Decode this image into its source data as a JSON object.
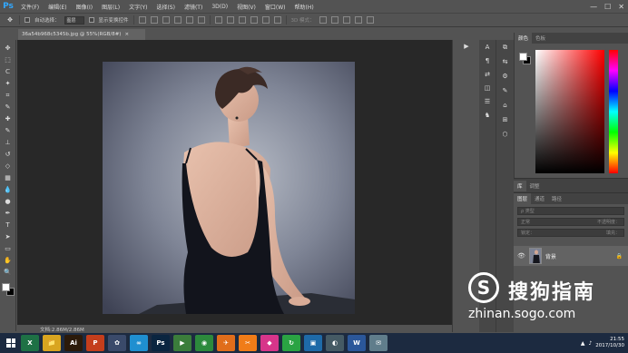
{
  "app": {
    "logo": "Ps"
  },
  "menu": [
    "文件(F)",
    "编辑(E)",
    "图像(I)",
    "图层(L)",
    "文字(Y)",
    "选择(S)",
    "滤镜(T)",
    "3D(D)",
    "视图(V)",
    "窗口(W)",
    "帮助(H)"
  ],
  "window_controls": [
    "—",
    "☐",
    "✕"
  ],
  "options_bar": {
    "auto_select_label": "自动选择：",
    "auto_select_value": "图层",
    "transform_label": "显示变换控件",
    "mode_label": "3D 模式："
  },
  "document_tab": {
    "title": "36a54b968c5345b.jpg @ 55%(RGB/8#)",
    "close": "×"
  },
  "status": {
    "doc_info": "文档:2.86M/2.86M"
  },
  "tools": [
    "move-icon",
    "marquee-icon",
    "lasso-icon",
    "magic-wand-icon",
    "crop-icon",
    "eyedropper-icon",
    "healing-icon",
    "brush-icon",
    "stamp-icon",
    "history-brush-icon",
    "eraser-icon",
    "gradient-icon",
    "blur-icon",
    "dodge-icon",
    "pen-icon",
    "type-icon",
    "path-select-icon",
    "shape-icon",
    "hand-icon",
    "zoom-icon"
  ],
  "tool_glyphs": [
    "✥",
    "⬚",
    "ᑕ",
    "✦",
    "⌗",
    "✎",
    "✚",
    "✎",
    "⊥",
    "↺",
    "◇",
    "▦",
    "💧",
    "●",
    "✒",
    "T",
    "➤",
    "▭",
    "✋",
    "🔍"
  ],
  "color_panel": {
    "tabs": [
      "颜色",
      "色板"
    ]
  },
  "lib_panel": {
    "tabs": [
      "库",
      "调整"
    ]
  },
  "layers_panel": {
    "tabs": [
      "图层",
      "通道",
      "路径"
    ],
    "kind_placeholder": "ρ 类型",
    "blend_mode": "正常",
    "opacity_label": "不透明度：",
    "lock_label": "锁定：",
    "fill_label": "填充：",
    "layer_name": "背景"
  },
  "taskbar": {
    "apps": [
      {
        "label": "X",
        "color": "#1e7145"
      },
      {
        "label": "📁",
        "color": "#d9a520"
      },
      {
        "label": "Ai",
        "color": "#2b1a0a"
      },
      {
        "label": "P",
        "color": "#c43e1c"
      },
      {
        "label": "✿",
        "color": "#3a4a6a"
      },
      {
        "label": "∞",
        "color": "#1f8fd0"
      },
      {
        "label": "Ps",
        "color": "#0a2540"
      },
      {
        "label": "▶",
        "color": "#3b7d3b"
      },
      {
        "label": "◉",
        "color": "#2c8a3c"
      },
      {
        "label": "✈",
        "color": "#e06d1b"
      },
      {
        "label": "✂",
        "color": "#f07c18"
      },
      {
        "label": "◆",
        "color": "#d7358a"
      },
      {
        "label": "↻",
        "color": "#2aa343"
      },
      {
        "label": "▣",
        "color": "#1e6aa8"
      },
      {
        "label": "◐",
        "color": "#455a64"
      },
      {
        "label": "W",
        "color": "#2b579a"
      },
      {
        "label": "✉",
        "color": "#607d8b"
      }
    ],
    "time": "21:55",
    "date": "2017/10/30"
  },
  "watermark": {
    "logo": "S",
    "brand": "搜狗指南",
    "url": "zhinan.sogo.com"
  },
  "colors": {
    "ps_blue": "#31a8ff",
    "ui_gray": "#535353",
    "canvas_bg": "#282828",
    "taskbar": "#1c2a40"
  }
}
